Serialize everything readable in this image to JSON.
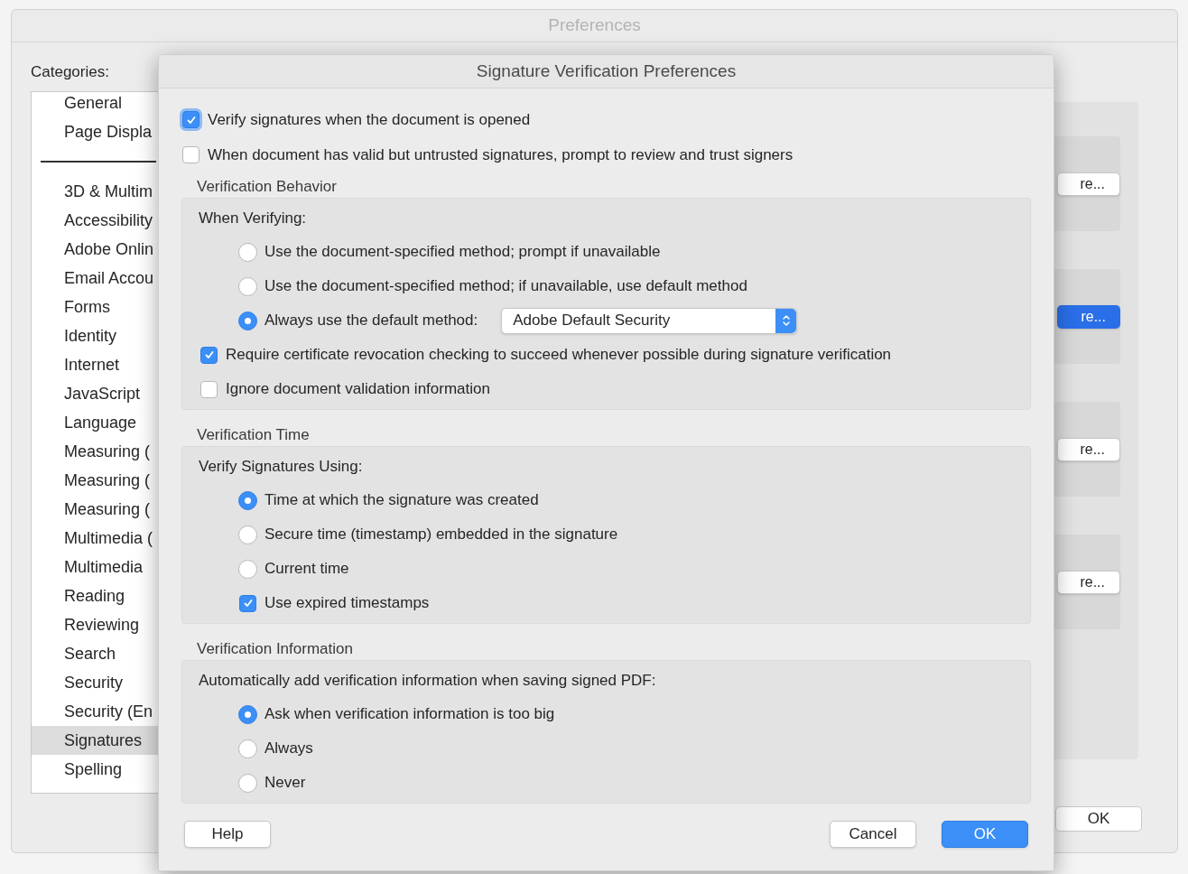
{
  "back_window": {
    "title": "Preferences",
    "categories_label": "Categories:",
    "categories": [
      {
        "kind": "item",
        "label": "General",
        "selected": false
      },
      {
        "kind": "item",
        "label": "Page Displa",
        "selected": false
      },
      {
        "kind": "separator"
      },
      {
        "kind": "item",
        "label": "3D & Multim",
        "selected": false
      },
      {
        "kind": "item",
        "label": "Accessibility",
        "selected": false
      },
      {
        "kind": "item",
        "label": "Adobe Onlin",
        "selected": false
      },
      {
        "kind": "item",
        "label": "Email Accou",
        "selected": false
      },
      {
        "kind": "item",
        "label": "Forms",
        "selected": false
      },
      {
        "kind": "item",
        "label": "Identity",
        "selected": false
      },
      {
        "kind": "item",
        "label": "Internet",
        "selected": false
      },
      {
        "kind": "item",
        "label": "JavaScript",
        "selected": false
      },
      {
        "kind": "item",
        "label": "Language",
        "selected": false
      },
      {
        "kind": "item",
        "label": "Measuring (",
        "selected": false
      },
      {
        "kind": "item",
        "label": "Measuring (",
        "selected": false
      },
      {
        "kind": "item",
        "label": "Measuring (",
        "selected": false
      },
      {
        "kind": "item",
        "label": "Multimedia (",
        "selected": false
      },
      {
        "kind": "item",
        "label": "Multimedia",
        "selected": false
      },
      {
        "kind": "item",
        "label": "Reading",
        "selected": false
      },
      {
        "kind": "item",
        "label": "Reviewing",
        "selected": false
      },
      {
        "kind": "item",
        "label": "Search",
        "selected": false
      },
      {
        "kind": "item",
        "label": "Security",
        "selected": false
      },
      {
        "kind": "item",
        "label": "Security (En",
        "selected": false
      },
      {
        "kind": "item",
        "label": "Signatures",
        "selected": true
      },
      {
        "kind": "item",
        "label": "Spelling",
        "selected": false
      }
    ],
    "side_buttons": [
      {
        "label": "re...",
        "default": false
      },
      {
        "label": "re...",
        "default": true
      },
      {
        "label": "re...",
        "default": false
      },
      {
        "label": "re...",
        "default": false
      }
    ],
    "ok_button": "OK"
  },
  "dialog": {
    "title": "Signature Verification Preferences",
    "options": [
      {
        "label": "Verify signatures when the document is opened",
        "checked": true,
        "focused": true
      },
      {
        "label": "When document has valid but untrusted signatures, prompt to review and trust signers",
        "checked": false,
        "focused": false
      }
    ],
    "sections": [
      {
        "heading": "Verification Behavior",
        "subheading": "When Verifying:",
        "choices": [
          {
            "kind": "radio",
            "label": "Use the document-specified method; prompt if unavailable",
            "selected": false
          },
          {
            "kind": "radio",
            "label": "Use the document-specified method; if unavailable, use default method",
            "selected": false
          },
          {
            "kind": "radio",
            "label": "Always use the default method:",
            "selected": true,
            "dropdown": "Adobe Default Security"
          }
        ],
        "options": [
          {
            "label": "Require certificate revocation checking to succeed whenever possible during signature verification",
            "checked": true
          },
          {
            "label": "Ignore document validation information",
            "checked": false
          }
        ]
      },
      {
        "heading": "Verification Time",
        "subheading": "Verify Signatures Using:",
        "choices": [
          {
            "kind": "radio",
            "label": "Time at which the signature was created",
            "selected": true
          },
          {
            "kind": "radio",
            "label": "Secure time (timestamp) embedded in the signature",
            "selected": false
          },
          {
            "kind": "radio",
            "label": "Current time",
            "selected": false
          },
          {
            "kind": "checkbox",
            "label": "Use expired timestamps",
            "checked": true
          }
        ]
      },
      {
        "heading": "Verification Information",
        "subheading": "Automatically add verification information when saving signed PDF:",
        "choices": [
          {
            "kind": "radio",
            "label": "Ask when verification information is too big",
            "selected": true
          },
          {
            "kind": "radio",
            "label": "Always",
            "selected": false
          },
          {
            "kind": "radio",
            "label": "Never",
            "selected": false
          }
        ]
      }
    ],
    "buttons": [
      {
        "label": "Help",
        "default": false
      },
      {
        "label": "Cancel",
        "default": false
      },
      {
        "label": "OK",
        "default": true
      }
    ]
  }
}
